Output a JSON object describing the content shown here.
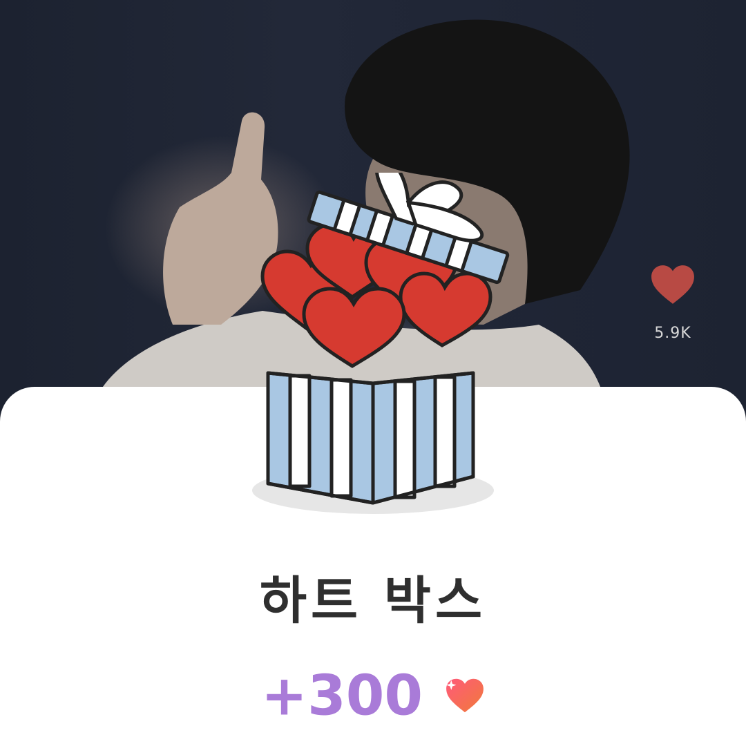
{
  "like_widget": {
    "icon": "heart-icon",
    "count": "5.9K",
    "color": "#b84a44"
  },
  "reward_popup": {
    "illustration": "gift-box-with-hearts",
    "title": "하트 박스",
    "amount": "+300",
    "amount_color": "#a97bd8",
    "currency_icon": "heart-icon"
  }
}
